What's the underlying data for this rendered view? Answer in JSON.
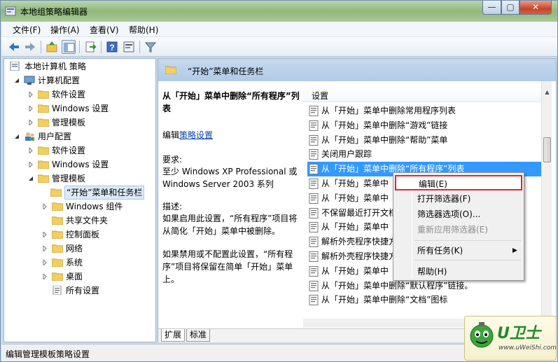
{
  "window": {
    "title": "本地组策略编辑器",
    "min": "—",
    "max": "▢",
    "close": "✕"
  },
  "menu": [
    "文件(F)",
    "操作(A)",
    "查看(V)",
    "帮助(H)"
  ],
  "toolbar": {
    "icons": [
      "back-arrow-icon",
      "forward-arrow-icon",
      "up-folder-icon",
      "show-tree-icon",
      "export-icon",
      "help-icon",
      "properties-icon",
      "filter-icon"
    ]
  },
  "tree": {
    "root": "本地计算机 策略",
    "computer_config": "计算机配置",
    "cc_software": "软件设置",
    "cc_windows": "Windows 设置",
    "cc_admin": "管理模板",
    "user_config": "用户配置",
    "uc_software": "软件设置",
    "uc_windows": "Windows 设置",
    "uc_admin": "管理模板",
    "start_menu": "“开始”菜单和任务栏",
    "win_components": "Windows 组件",
    "shared_folders": "共享文件夹",
    "control_panel": "控制面板",
    "network": "网络",
    "system": "系统",
    "desktop": "桌面",
    "all_settings": "所有设置"
  },
  "header": {
    "title": "“开始”菜单和任务栏"
  },
  "description": {
    "title": "从「开始」菜单中删除“所有程序”列表",
    "edit_prefix": "编辑",
    "edit_link": "策略设置",
    "req_label": "要求:",
    "req_text": "至少 Windows XP Professional 或 Windows Server 2003 系列",
    "desc_label": "描述:",
    "desc_text": "如果启用此设置，“所有程序”项目将从简化「开始」菜单中被删除。",
    "desc_text2": "如果禁用或不配置此设置，“所有程序”项目将保留在简单「开始」菜单上。"
  },
  "list": {
    "header": "设置",
    "items": [
      "从「开始」菜单中删除常用程序列表",
      "从「开始」菜单中删除“游戏”链接",
      "从「开始」菜单中删除“帮助”菜单",
      "关闭用户跟踪",
      "从「开始」菜单中删除“所有程序”列表",
      "从「开始」菜单中",
      "从「开始」菜单中",
      "不保留最近打开文档",
      "从「开始」菜单中",
      "解析外壳程序快捷方",
      "解析外壳程序快捷方",
      "从「开始」菜单中",
      "从「开始」菜单中删除“默认程序”链接。",
      "从「开始」菜单中删除“文档”图标"
    ]
  },
  "tabs": [
    "扩展",
    "标准"
  ],
  "status": "编辑管理模板策略设置",
  "context_menu": {
    "edit": "编辑(E)",
    "open_filter": "打开筛选器(F)",
    "filter_options": "筛选器选项(O)...",
    "reapply_filter": "重新应用筛选器(E)",
    "all_tasks": "所有任务(K)",
    "help": "帮助(H)"
  },
  "watermark": {
    "brand": "U卫士",
    "url": "www.uWeiShi.com"
  },
  "colors": {
    "selection": "#3399ff",
    "header_bg": "#c6d9ee",
    "highlight_border": "#e4262f"
  }
}
